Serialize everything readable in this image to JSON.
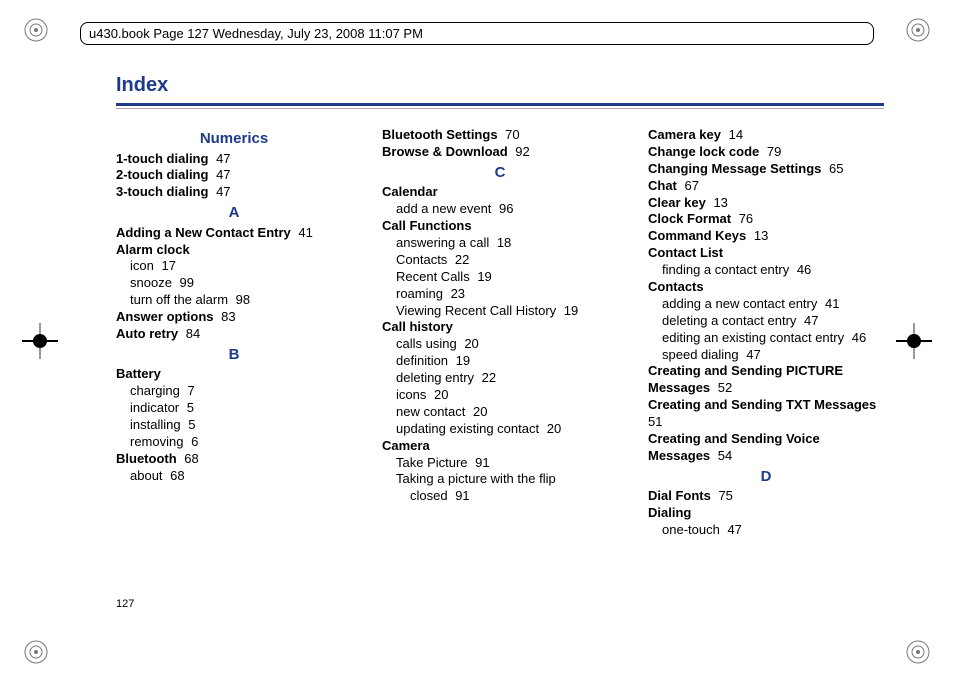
{
  "header": "u430.book  Page 127  Wednesday, July 23, 2008  11:07 PM",
  "title": "Index",
  "pageNumber": "127",
  "columns": [
    {
      "items": [
        {
          "type": "letter",
          "text": "Numerics"
        },
        {
          "type": "bold",
          "text": "1-touch dialing",
          "page": "47"
        },
        {
          "type": "bold",
          "text": "2-touch dialing",
          "page": "47"
        },
        {
          "type": "bold",
          "text": "3-touch dialing",
          "page": "47"
        },
        {
          "type": "letter",
          "text": "A"
        },
        {
          "type": "bold",
          "text": "Adding a New Contact Entry",
          "page": "41"
        },
        {
          "type": "bold",
          "text": "Alarm clock"
        },
        {
          "type": "sub",
          "text": "icon",
          "page": "17"
        },
        {
          "type": "sub",
          "text": "snooze",
          "page": "99"
        },
        {
          "type": "sub",
          "text": "turn off the alarm",
          "page": "98"
        },
        {
          "type": "bold",
          "text": "Answer options",
          "page": "83"
        },
        {
          "type": "bold",
          "text": "Auto retry",
          "page": "84"
        },
        {
          "type": "letter",
          "text": "B"
        },
        {
          "type": "bold",
          "text": "Battery"
        },
        {
          "type": "sub",
          "text": "charging",
          "page": "7"
        },
        {
          "type": "sub",
          "text": "indicator",
          "page": "5"
        },
        {
          "type": "sub",
          "text": "installing",
          "page": "5"
        },
        {
          "type": "sub",
          "text": "removing",
          "page": "6"
        },
        {
          "type": "bold",
          "text": "Bluetooth",
          "page": "68"
        },
        {
          "type": "sub",
          "text": "about",
          "page": "68"
        }
      ]
    },
    {
      "items": [
        {
          "type": "bold",
          "text": "Bluetooth Settings",
          "page": "70"
        },
        {
          "type": "bold",
          "text": "Browse & Download",
          "page": "92"
        },
        {
          "type": "letter",
          "text": "C"
        },
        {
          "type": "bold",
          "text": "Calendar"
        },
        {
          "type": "sub",
          "text": "add a new event",
          "page": "96"
        },
        {
          "type": "bold",
          "text": "Call Functions"
        },
        {
          "type": "sub",
          "text": "answering a call",
          "page": "18"
        },
        {
          "type": "sub",
          "text": "Contacts",
          "page": "22"
        },
        {
          "type": "sub",
          "text": "Recent Calls",
          "page": "19"
        },
        {
          "type": "sub",
          "text": "roaming",
          "page": "23"
        },
        {
          "type": "sub",
          "text": "Viewing Recent Call History",
          "page": "19"
        },
        {
          "type": "bold",
          "text": "Call history"
        },
        {
          "type": "sub",
          "text": "calls using",
          "page": "20"
        },
        {
          "type": "sub",
          "text": "definition",
          "page": "19"
        },
        {
          "type": "sub",
          "text": "deleting entry",
          "page": "22"
        },
        {
          "type": "sub",
          "text": "icons",
          "page": "20"
        },
        {
          "type": "sub",
          "text": "new contact",
          "page": "20"
        },
        {
          "type": "sub",
          "text": "updating existing contact",
          "page": "20"
        },
        {
          "type": "bold",
          "text": "Camera"
        },
        {
          "type": "sub",
          "text": "Take Picture",
          "page": "91"
        },
        {
          "type": "sub",
          "text": "Taking a picture with the flip"
        },
        {
          "type": "sub2",
          "text": "closed",
          "page": "91"
        }
      ]
    },
    {
      "items": [
        {
          "type": "bold",
          "text": "Camera key",
          "page": "14"
        },
        {
          "type": "bold",
          "text": "Change lock code",
          "page": "79"
        },
        {
          "type": "bold",
          "text": "Changing Message Settings",
          "page": "65"
        },
        {
          "type": "bold",
          "text": "Chat",
          "page": "67"
        },
        {
          "type": "bold",
          "text": "Clear key",
          "page": "13"
        },
        {
          "type": "bold",
          "text": "Clock Format",
          "page": "76"
        },
        {
          "type": "bold",
          "text": "Command Keys",
          "page": "13"
        },
        {
          "type": "bold",
          "text": "Contact List"
        },
        {
          "type": "sub",
          "text": "finding a contact entry",
          "page": "46"
        },
        {
          "type": "bold",
          "text": "Contacts"
        },
        {
          "type": "sub",
          "text": "adding a new contact entry",
          "page": "41"
        },
        {
          "type": "sub",
          "text": "deleting a contact entry",
          "page": "47"
        },
        {
          "type": "sub",
          "text": "editing an existing contact entry",
          "page": "46"
        },
        {
          "type": "sub",
          "text": "speed dialing",
          "page": "47"
        },
        {
          "type": "bold",
          "text": "Creating and Sending PICTURE"
        },
        {
          "type": "bold",
          "text": "Messages",
          "page": "52"
        },
        {
          "type": "bold",
          "text": "Creating and Sending TXT Messages",
          "page": "51"
        },
        {
          "type": "bold",
          "text": "Creating and Sending Voice"
        },
        {
          "type": "bold",
          "text": "Messages",
          "page": "54"
        },
        {
          "type": "letter",
          "text": "D"
        },
        {
          "type": "bold",
          "text": "Dial Fonts",
          "page": "75"
        },
        {
          "type": "bold",
          "text": "Dialing"
        },
        {
          "type": "sub",
          "text": "one-touch",
          "page": "47"
        }
      ]
    }
  ]
}
